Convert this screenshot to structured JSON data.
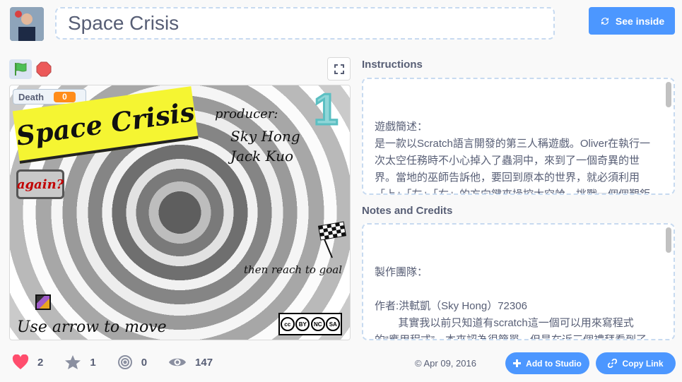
{
  "project": {
    "title": "Space Crisis",
    "see_inside_label": "See inside"
  },
  "controls": {
    "green_flag_icon": "green-flag-icon",
    "stop_icon": "stop-icon",
    "fullscreen_icon": "fullscreen-icon"
  },
  "stage": {
    "death_label": "Death",
    "death_value": "0",
    "game_title": "Space Crisis",
    "producer_label": "producer:",
    "producer_names": [
      "Sky Hong",
      "Jack Kuo"
    ],
    "level_number": "1",
    "again_label": "again?",
    "goal_text": "then reach to goal",
    "move_text": "Use arrow to move",
    "cc_labels": [
      "cc",
      "BY",
      "NC",
      "SA"
    ]
  },
  "instructions": {
    "heading": "Instructions",
    "text": "遊戲簡述：\n是一款以Scratch語言開發的第三人稱遊戲。Oliver在執行一次太空任務時不小心掉入了蟲洞中，來到了一個奇異的世界。當地的巫師告訴他，要回到原本的世界，就必須利用「上」「左」「右」的方向鍵來操控太空艙，挑戰一個個艱鉅的任務，有岩漿以及隨機掉落的隕石，有些陷阱甚至還會會隱形。穿過10個關卡，就能夠回到"
  },
  "notes": {
    "heading": "Notes and Credits",
    "text": "製作團隊：\n\n作者:洪軾凱（Sky Hong）72306\n        其實我以前只知道有scratch這一個可以用來寫程式的“應用程式”，本來認為很簡單，但是在近三個禮拜看到了這一個比賽，實際自學的時候才覺得他可以在我學"
  },
  "stats": {
    "loves": "2",
    "favorites": "1",
    "remixes": "0",
    "views": "147"
  },
  "footer": {
    "date": "Apr 09, 2016",
    "copyright_symbol": "©",
    "add_to_studio_label": "Add to Studio",
    "copy_link_label": "Copy Link"
  },
  "colors": {
    "accent": "#4c97ff",
    "heart": "#ff4d6d",
    "death_value_bg": "#ff8c1a",
    "banner_yellow": "#f5f532"
  }
}
